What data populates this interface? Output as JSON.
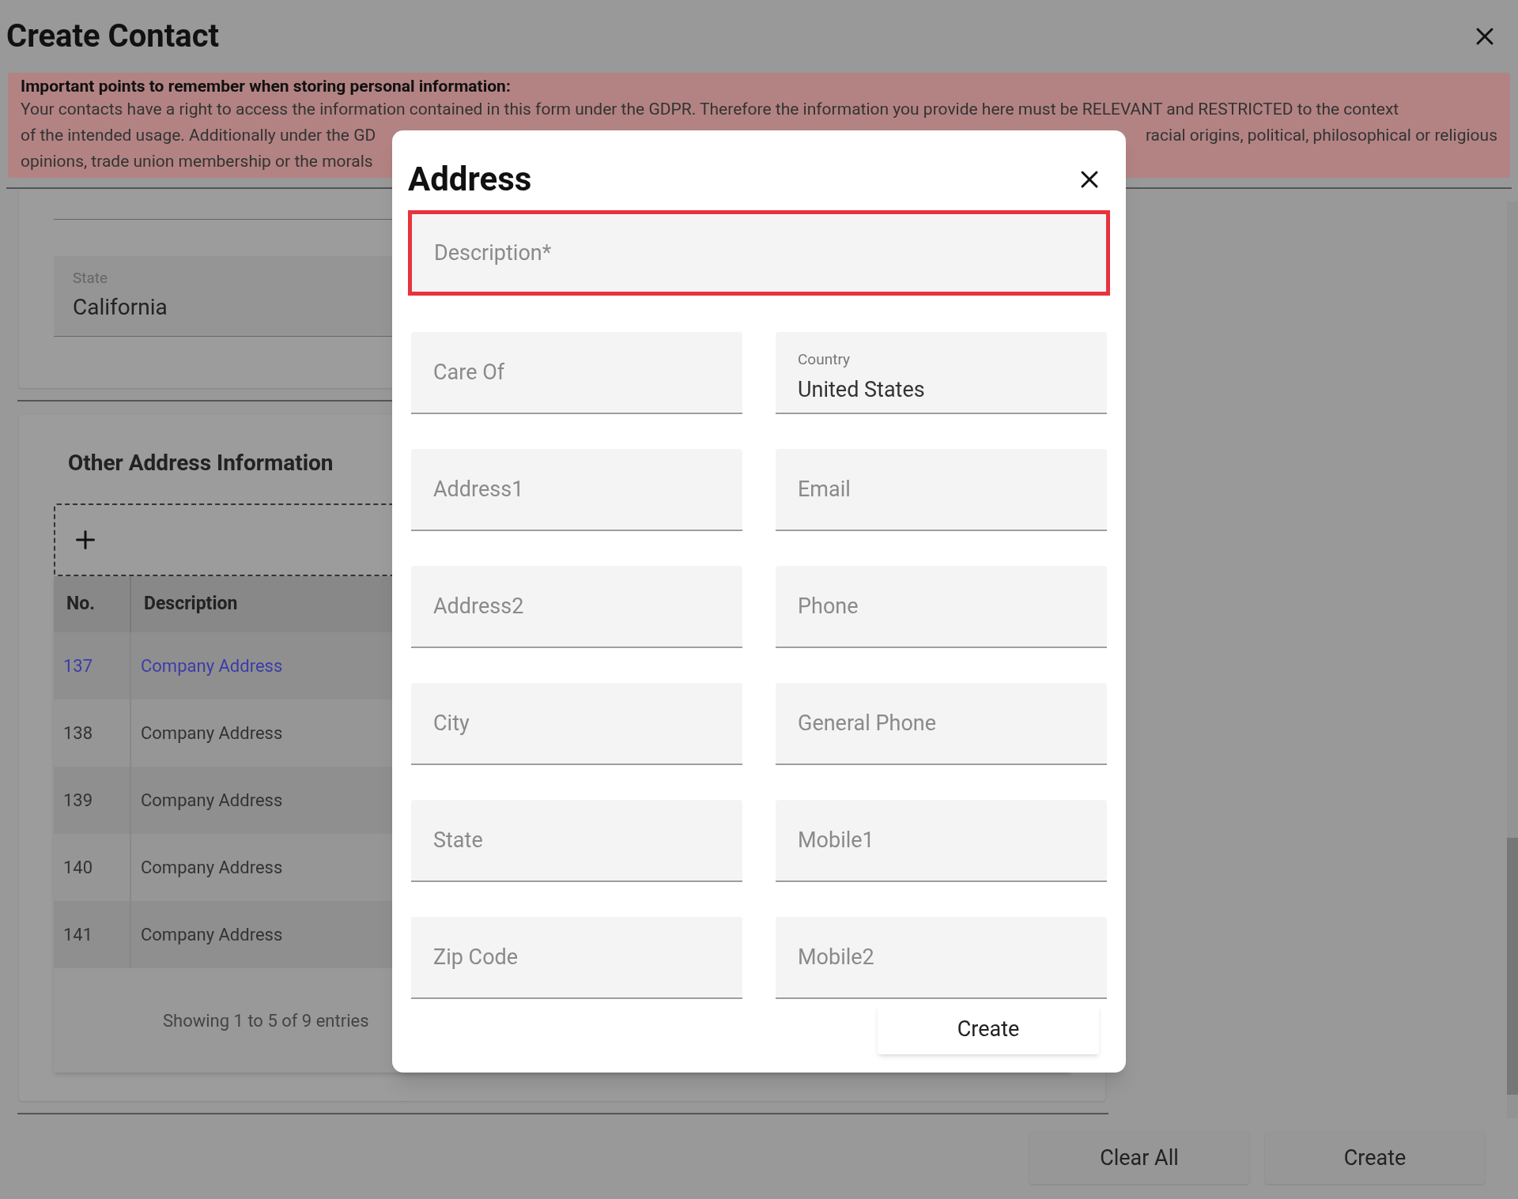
{
  "window": {
    "title": "Create Contact"
  },
  "notice": {
    "heading": "Important points to remember when storing personal information:",
    "lines": [
      {
        "segments": [
          "Your contacts have a right to access the information contained in this form under the GDPR. Therefore the information you provide here must be RELEVANT and RESTRICTED to the context"
        ]
      },
      {
        "segments": [
          "of the intended usage. Additionally under the GD",
          "racial origins, political, philosophical or religious"
        ]
      },
      {
        "segments": [
          "opinions, trade union membership or the morals"
        ]
      }
    ]
  },
  "state_field": {
    "label": "State",
    "value": "California"
  },
  "other_address": {
    "title": "Other Address Information",
    "table": {
      "columns": [
        "No.",
        "Description"
      ],
      "rows": [
        {
          "cells": [
            "137",
            "Company Address"
          ],
          "selected": true
        },
        {
          "cells": [
            "138",
            "Company Address"
          ],
          "selected": false
        },
        {
          "cells": [
            "139",
            "Company Address"
          ],
          "selected": false
        },
        {
          "cells": [
            "140",
            "Company Address"
          ],
          "selected": false
        },
        {
          "cells": [
            "141",
            "Company Address"
          ],
          "selected": false
        }
      ],
      "footer": "Showing 1 to 5 of 9 entries"
    }
  },
  "footer_buttons": [
    "Clear All",
    "Create"
  ],
  "dialog": {
    "title": "Address",
    "description": {
      "placeholder": "Description*",
      "invalid": true
    },
    "fields": [
      {
        "placeholder": "Care Of"
      },
      {
        "label": "Country",
        "value": "United States"
      },
      {
        "placeholder": "Address1"
      },
      {
        "placeholder": "Email"
      },
      {
        "placeholder": "Address2"
      },
      {
        "placeholder": "Phone"
      },
      {
        "placeholder": "City"
      },
      {
        "placeholder": "General Phone"
      },
      {
        "placeholder": "State"
      },
      {
        "placeholder": "Mobile1"
      },
      {
        "placeholder": "Zip Code"
      },
      {
        "placeholder": "Mobile2"
      }
    ],
    "submit": "Create"
  }
}
